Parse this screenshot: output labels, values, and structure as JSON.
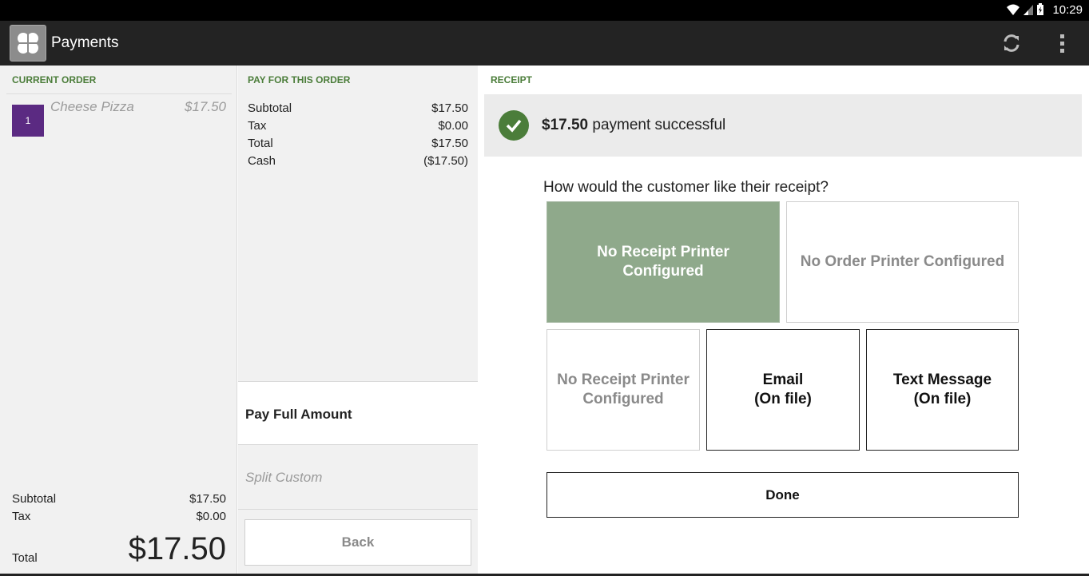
{
  "status_bar": {
    "time": "10:29",
    "icons": [
      "wifi-icon",
      "signal-icon",
      "battery-icon"
    ]
  },
  "action_bar": {
    "title": "Payments",
    "icons": [
      "app-logo-icon",
      "refresh-icon",
      "overflow-menu-icon"
    ]
  },
  "current_order": {
    "header": "CURRENT ORDER",
    "items": [
      {
        "qty": "1",
        "name": "Cheese Pizza",
        "price": "$17.50"
      }
    ],
    "subtotal_label": "Subtotal",
    "subtotal_value": "$17.50",
    "tax_label": "Tax",
    "tax_value": "$0.00",
    "total_label": "Total",
    "total_value": "$17.50"
  },
  "pay_for_order": {
    "header": "PAY FOR THIS ORDER",
    "rows": [
      {
        "label": "Subtotal",
        "value": "$17.50"
      },
      {
        "label": "Tax",
        "value": "$0.00"
      },
      {
        "label": "Total",
        "value": "$17.50"
      },
      {
        "label": "Cash",
        "value": "($17.50)"
      }
    ],
    "pay_full_label": "Pay Full Amount",
    "split_custom_label": "Split Custom",
    "back_label": "Back"
  },
  "receipt": {
    "header": "RECEIPT",
    "success_amount": "$17.50",
    "success_text": "payment successful",
    "prompt": "How would the customer like their receipt?",
    "tiles": {
      "receipt_main_line1": "No Receipt Printer",
      "receipt_main_line2": "Configured",
      "order_printer": "No Order Printer Configured",
      "receipt_small_line1": "No Receipt Printer",
      "receipt_small_line2": "Configured",
      "email_line1": "Email",
      "email_line2": "(On file)",
      "text_line1": "Text Message",
      "text_line2": "(On file)"
    },
    "done_label": "Done"
  },
  "colors": {
    "accent_green": "#4b7d3a",
    "tile_green": "#8fa98b",
    "qty_purple": "#5b2a82",
    "action_bar": "#232323"
  }
}
